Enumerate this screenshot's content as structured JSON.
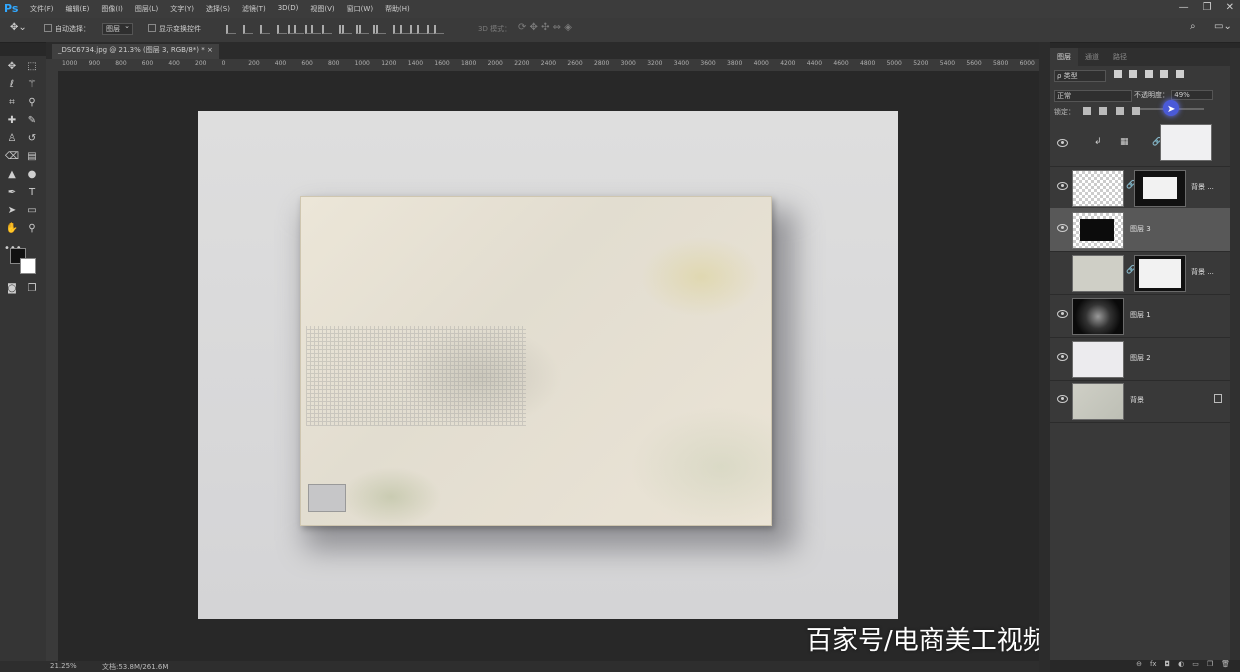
{
  "app": {
    "logo": "Ps"
  },
  "menu": [
    "文件(F)",
    "编辑(E)",
    "图像(I)",
    "图层(L)",
    "文字(Y)",
    "选择(S)",
    "滤镜(T)",
    "3D(D)",
    "视图(V)",
    "窗口(W)",
    "帮助(H)"
  ],
  "window_controls": [
    "—",
    "❐",
    "✕"
  ],
  "options_bar": {
    "auto_select_label": "自动选择：",
    "auto_select_value": "图层",
    "show_transform_label": "显示变换控件",
    "mode_3d_label": "3D 模式："
  },
  "document": {
    "tab_title": "_DSC6734.jpg @ 21.3% (图层 3, RGB/8*) *",
    "tab_close": "×"
  },
  "ruler_ticks": [
    "1000",
    "900",
    "800",
    "600",
    "400",
    "200",
    "0",
    "200",
    "400",
    "600",
    "800",
    "1000",
    "1200",
    "1400",
    "1600",
    "1800",
    "2000",
    "2200",
    "2400",
    "2600",
    "2800",
    "3000",
    "3200",
    "3400",
    "3600",
    "3800",
    "4000",
    "4200",
    "4400",
    "4600",
    "4800",
    "5000",
    "5200",
    "5400",
    "5600",
    "5800",
    "6000"
  ],
  "status": {
    "zoom": "21.25%",
    "doc_info": "文档:53.8M/261.6M"
  },
  "watermark": "百家号/电商美工视频教程大全",
  "layers_panel": {
    "tabs": [
      "图层",
      "通道",
      "路径"
    ],
    "filter_label": "ρ 类型",
    "blend_mode": "正常",
    "opacity_label": "不透明度：",
    "opacity_value": "49%",
    "opacity_fraction": 0.49,
    "lock_label": "锁定：",
    "layers": [
      {
        "name": "",
        "visible": true,
        "selected": false,
        "type": "adjustment"
      },
      {
        "name": "背景 ...",
        "visible": true,
        "selected": false,
        "type": "masked"
      },
      {
        "name": "图层 3",
        "visible": true,
        "selected": true,
        "type": "pixel"
      },
      {
        "name": "背景 ...",
        "visible": false,
        "selected": false,
        "type": "masked"
      },
      {
        "name": "图层 1",
        "visible": true,
        "selected": false,
        "type": "pixel"
      },
      {
        "name": "图层 2",
        "visible": true,
        "selected": false,
        "type": "pixel"
      },
      {
        "name": "背景",
        "visible": true,
        "selected": false,
        "type": "locked"
      }
    ],
    "footer": [
      "⊖",
      "fx",
      "◘",
      "◐",
      "▭",
      "❐",
      "🗑"
    ]
  },
  "colors": {
    "accent": "#31a8ff",
    "selected_layer": "#585858",
    "cursor_highlight": "#4a5ad8"
  }
}
